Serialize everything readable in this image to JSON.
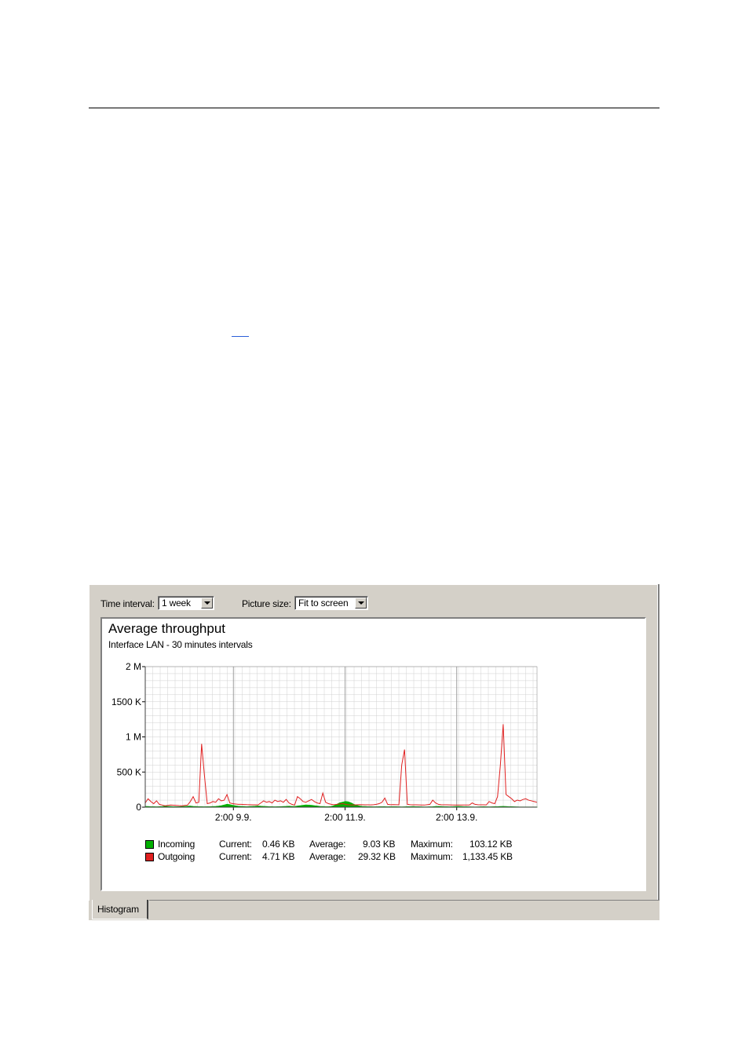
{
  "toolbar": {
    "time_interval_label": "Time interval:",
    "time_interval_value": "1 week",
    "picture_size_label": "Picture size:",
    "picture_size_value": "Fit to screen"
  },
  "tabs": [
    {
      "label": "Histogram",
      "selected": true
    }
  ],
  "colors": {
    "incoming": "#00b000",
    "outgoing": "#e02020",
    "grid": "#d0d0d0",
    "panel_bg": "#d4d0c8"
  },
  "chart_data": {
    "type": "area",
    "title": "Average throughput",
    "subtitle": "Interface LAN - 30 minutes intervals",
    "y_ticks": [
      "2 M",
      "1500 K",
      "1 M",
      "500 K",
      "0"
    ],
    "ylim": [
      0,
      2000
    ],
    "y_unit_base": "K",
    "x_ticks": [
      "2:00 9.9.",
      "2:00 11.9.",
      "2:00 13.9."
    ],
    "grid": true,
    "series": [
      {
        "name": "Incoming",
        "color": "#00b000",
        "current": "0.46 KB",
        "average": "9.03 KB",
        "maximum": "103.12 KB",
        "values": [
          10,
          8,
          6,
          5,
          4,
          6,
          8,
          12,
          10,
          8,
          6,
          5,
          6,
          8,
          10,
          12,
          14,
          10,
          8,
          6,
          5,
          4,
          5,
          6,
          8,
          10,
          14,
          20,
          30,
          40,
          35,
          25,
          18,
          12,
          10,
          8,
          6,
          8,
          10,
          12,
          15,
          12,
          10,
          8,
          6,
          5,
          4,
          5,
          6,
          8,
          10,
          12,
          10,
          8,
          15,
          20,
          25,
          30,
          28,
          25,
          20,
          15,
          10,
          8,
          6,
          5,
          10,
          20,
          40,
          60,
          70,
          80,
          75,
          60,
          40,
          25,
          15,
          10,
          8,
          6,
          5,
          4,
          4,
          5,
          6,
          5,
          4,
          5,
          6,
          5,
          4,
          3,
          4,
          5,
          6,
          8,
          6,
          5,
          4,
          3,
          3,
          4,
          5,
          8,
          10,
          8,
          6,
          5,
          4,
          6,
          8,
          10,
          8,
          6,
          5,
          4,
          3,
          2,
          3,
          4,
          5,
          4,
          3,
          4,
          5,
          6,
          8,
          10,
          8,
          6,
          5,
          4,
          3,
          2,
          1,
          1,
          2,
          2,
          1,
          1
        ]
      },
      {
        "name": "Outgoing",
        "color": "#e02020",
        "current": "4.71 KB",
        "average": "29.32 KB",
        "maximum": "1,133.45 KB",
        "values": [
          60,
          120,
          80,
          50,
          90,
          40,
          30,
          20,
          25,
          30,
          28,
          25,
          22,
          20,
          25,
          30,
          80,
          150,
          60,
          70,
          900,
          450,
          50,
          60,
          80,
          70,
          120,
          90,
          100,
          180,
          60,
          50,
          45,
          40,
          40,
          38,
          36,
          35,
          34,
          33,
          32,
          60,
          90,
          70,
          80,
          60,
          100,
          80,
          90,
          70,
          110,
          60,
          40,
          30,
          150,
          120,
          80,
          70,
          90,
          110,
          80,
          60,
          50,
          200,
          70,
          50,
          40,
          35,
          40,
          45,
          50,
          40,
          35,
          30,
          32,
          34,
          36,
          35,
          34,
          33,
          32,
          35,
          40,
          50,
          70,
          130,
          40,
          35,
          36,
          35,
          34,
          600,
          820,
          40,
          35,
          34,
          33,
          32,
          31,
          30,
          35,
          40,
          100,
          60,
          40,
          35,
          34,
          33,
          32,
          31,
          30,
          30,
          30,
          30,
          30,
          30,
          60,
          40,
          35,
          34,
          33,
          32,
          80,
          60,
          50,
          150,
          600,
          1180,
          180,
          150,
          120,
          80,
          100,
          90,
          110,
          120,
          100,
          90,
          80,
          70
        ]
      }
    ],
    "legend_labels": {
      "current": "Current:",
      "average": "Average:",
      "maximum": "Maximum:"
    }
  }
}
